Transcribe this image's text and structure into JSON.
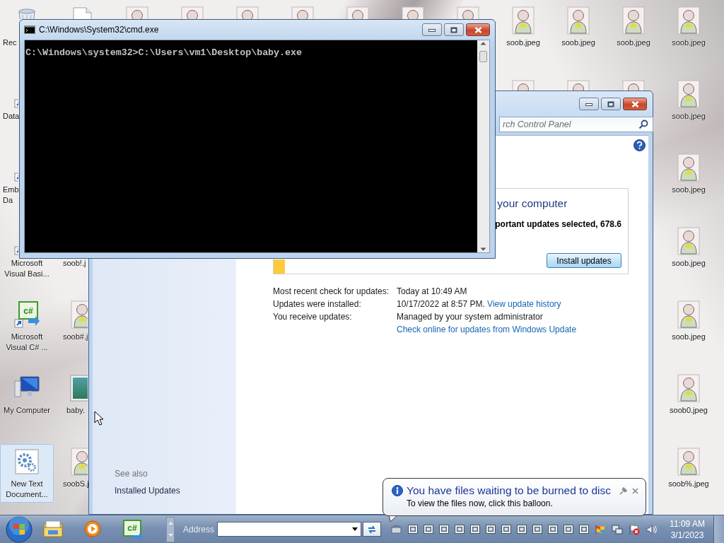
{
  "desktop": {
    "icons": [
      {
        "kind": "recycle",
        "lines": [
          "Rec"
        ],
        "selected": false
      },
      {
        "kind": "molecule",
        "lines": [
          "Data"
        ],
        "selected": false
      },
      {
        "kind": "red_app",
        "lines": [
          "Emb",
          "Da"
        ],
        "selected": false
      },
      {
        "kind": "window_app",
        "lines": [
          "Microsoft",
          "Visual Basi..."
        ],
        "selected": false
      },
      {
        "kind": "csharp",
        "glyph": "c#",
        "lines": [
          "Microsoft",
          "Visual C# ..."
        ],
        "selected": false
      },
      {
        "kind": "computer",
        "lines": [
          "My Computer"
        ],
        "selected": false
      },
      {
        "kind": "gears",
        "lines": [
          "New Text",
          "Document..."
        ],
        "selected": true
      },
      {
        "kind": "document",
        "selected": false
      },
      {
        "kind": "image",
        "lines": [
          "soob!.j"
        ],
        "selected": false
      },
      {
        "kind": "image",
        "lines": [
          "soob#.j"
        ],
        "selected": false
      },
      {
        "kind": "picture",
        "lines": [
          "baby."
        ],
        "selected": false
      },
      {
        "kind": "image",
        "lines": [
          "soobS.j"
        ],
        "selected": false
      },
      {
        "kind": "image",
        "selected": false
      },
      {
        "kind": "image",
        "selected": false
      },
      {
        "kind": "image",
        "selected": false
      },
      {
        "kind": "image",
        "selected": false
      },
      {
        "kind": "image",
        "selected": false
      },
      {
        "kind": "image",
        "selected": false
      },
      {
        "kind": "image",
        "selected": false
      },
      {
        "kind": "image",
        "lines": [
          "soob.jpeg"
        ],
        "selected": false
      },
      {
        "kind": "image",
        "lines": [
          "soob.jpeg"
        ],
        "selected": false
      },
      {
        "kind": "image",
        "lines": [
          "soob.jpeg"
        ],
        "selected": false
      },
      {
        "kind": "image",
        "lines": [
          "soob.jpeg"
        ],
        "selected": false
      },
      {
        "kind": "image",
        "selected": false
      },
      {
        "kind": "image",
        "selected": false
      },
      {
        "kind": "image",
        "selected": false
      },
      {
        "kind": "image",
        "lines": [
          "soob.jpeg"
        ],
        "selected": false
      },
      {
        "kind": "image",
        "lines": [
          "soob.jpeg"
        ],
        "selected": false
      },
      {
        "kind": "image",
        "lines": [
          "soob.jpeg"
        ],
        "selected": false
      },
      {
        "kind": "image",
        "lines": [
          "soob.jpeg"
        ],
        "selected": false
      },
      {
        "kind": "image",
        "lines": [
          "soob0.jpeg"
        ],
        "selected": false
      },
      {
        "kind": "image",
        "lines": [
          "soob%.jpeg"
        ],
        "selected": false
      }
    ]
  },
  "update_window": {
    "search": {
      "placeholder": "rch Control Panel"
    },
    "sidebar": {
      "heading": "See also",
      "links": [
        "Installed Updates"
      ]
    },
    "status_box": {
      "heading": "your computer",
      "summary": "portant updates selected, 678.6",
      "button": "Install updates"
    },
    "details": [
      {
        "label": "Most recent check for updates:",
        "value": "Today at 10:49 AM"
      },
      {
        "label": "Updates were installed:",
        "value": "10/17/2022 at 8:57 PM.",
        "link": "View update history"
      },
      {
        "label": "You receive updates:",
        "value": "Managed by your system administrator"
      },
      {
        "link": "Check online for updates from Windows Update"
      }
    ]
  },
  "console_window": {
    "title": "C:\\Windows\\System32\\cmd.exe",
    "lines": [
      "C:\\Windows\\system32>C:\\Users\\vm1\\Desktop\\baby.exe"
    ]
  },
  "balloon": {
    "title": "You have files waiting to be burned to disc",
    "text": "To view the files now, click this balloon."
  },
  "taskbar": {
    "pinned": [
      {
        "kind": "explorer"
      },
      {
        "kind": "media"
      },
      {
        "kind": "csharp",
        "glyph": "c#"
      }
    ],
    "address": {
      "label": "Address"
    },
    "clock": {
      "time": "11:09 AM",
      "date": "3/1/2023"
    }
  }
}
